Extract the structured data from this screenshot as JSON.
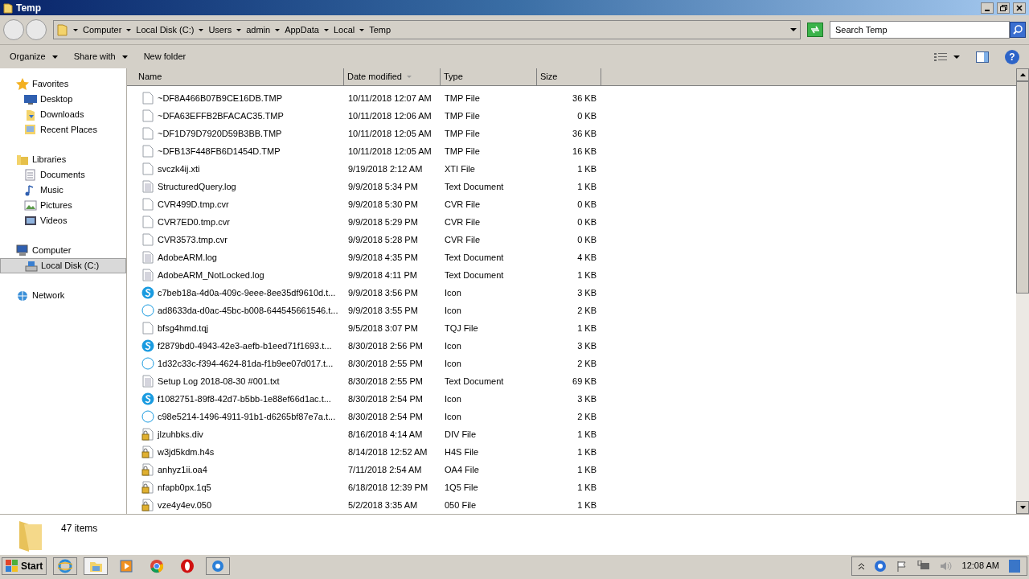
{
  "window": {
    "title": "Temp"
  },
  "breadcrumb": [
    "Computer",
    "Local Disk (C:)",
    "Users",
    "admin",
    "AppData",
    "Local",
    "Temp"
  ],
  "search": {
    "placeholder": "Search Temp"
  },
  "toolbar": [
    {
      "label": "Organize",
      "dropdown": true
    },
    {
      "label": "Share with",
      "dropdown": true
    },
    {
      "label": "New folder",
      "dropdown": false
    }
  ],
  "sidebar": {
    "items": [
      {
        "label": "Favorites",
        "kind": "star",
        "selected": false,
        "children": [
          {
            "label": "Desktop",
            "kind": "desktop",
            "selected": false
          },
          {
            "label": "Downloads",
            "kind": "folder",
            "selected": false
          },
          {
            "label": "Recent Places",
            "kind": "recent",
            "selected": false
          }
        ]
      },
      {
        "label": "Libraries",
        "kind": "library",
        "selected": false,
        "children": [
          {
            "label": "Documents",
            "kind": "doc",
            "selected": false
          },
          {
            "label": "Music",
            "kind": "music",
            "selected": false
          },
          {
            "label": "Pictures",
            "kind": "picture",
            "selected": false
          },
          {
            "label": "Videos",
            "kind": "video",
            "selected": false
          }
        ]
      },
      {
        "label": "Computer",
        "kind": "computer",
        "selected": false,
        "children": [
          {
            "label": "Local Disk (C:)",
            "kind": "disk",
            "selected": true
          }
        ]
      },
      {
        "label": "Network",
        "kind": "network",
        "selected": false
      }
    ]
  },
  "help_button": "?",
  "table": {
    "columns": [
      {
        "label": "Name",
        "sorted": false
      },
      {
        "label": "Date modified",
        "sorted": true
      },
      {
        "label": "Type",
        "sorted": false
      },
      {
        "label": "Size",
        "sorted": false
      }
    ],
    "rows": [
      {
        "kind": "blank",
        "name": "~DF8A466B07B9CE16DB.TMP",
        "date": "10/11/2018 12:07 AM",
        "type": "TMP File",
        "size": "36 KB"
      },
      {
        "kind": "blank",
        "name": "~DFA63EFFB2BFACAC35.TMP",
        "date": "10/11/2018 12:06 AM",
        "type": "TMP File",
        "size": "0 KB"
      },
      {
        "kind": "blank",
        "name": "~DF1D79D7920D59B3BB.TMP",
        "date": "10/11/2018 12:05 AM",
        "type": "TMP File",
        "size": "36 KB"
      },
      {
        "kind": "blank",
        "name": "~DFB13F448FB6D1454D.TMP",
        "date": "10/11/2018 12:05 AM",
        "type": "TMP File",
        "size": "16 KB"
      },
      {
        "kind": "blank",
        "name": "svczk4ij.xti",
        "date": "9/19/2018 2:12 AM",
        "type": "XTI File",
        "size": "1 KB"
      },
      {
        "kind": "text",
        "name": "StructuredQuery.log",
        "date": "9/9/2018 5:34 PM",
        "type": "Text Document",
        "size": "1 KB"
      },
      {
        "kind": "blank",
        "name": "CVR499D.tmp.cvr",
        "date": "9/9/2018 5:30 PM",
        "type": "CVR File",
        "size": "0 KB"
      },
      {
        "kind": "blank",
        "name": "CVR7ED0.tmp.cvr",
        "date": "9/9/2018 5:29 PM",
        "type": "CVR File",
        "size": "0 KB"
      },
      {
        "kind": "blank",
        "name": "CVR3573.tmp.cvr",
        "date": "9/9/2018 5:28 PM",
        "type": "CVR File",
        "size": "0 KB"
      },
      {
        "kind": "text",
        "name": "AdobeARM.log",
        "date": "9/9/2018 4:35 PM",
        "type": "Text Document",
        "size": "4 KB"
      },
      {
        "kind": "text",
        "name": "AdobeARM_NotLocked.log",
        "date": "9/9/2018 4:11 PM",
        "type": "Text Document",
        "size": "1 KB"
      },
      {
        "kind": "skype",
        "name": "c7beb18a-4d0a-409c-9eee-8ee35df9610d.t...",
        "date": "9/9/2018 3:56 PM",
        "type": "Icon",
        "size": "3 KB"
      },
      {
        "kind": "outline",
        "name": "ad8633da-d0ac-45bc-b008-644545661546.t...",
        "date": "9/9/2018 3:55 PM",
        "type": "Icon",
        "size": "2 KB"
      },
      {
        "kind": "blank",
        "name": "bfsg4hmd.tqj",
        "date": "9/5/2018 3:07 PM",
        "type": "TQJ File",
        "size": "1 KB"
      },
      {
        "kind": "skype",
        "name": "f2879bd0-4943-42e3-aefb-b1eed71f1693.t...",
        "date": "8/30/2018 2:56 PM",
        "type": "Icon",
        "size": "3 KB"
      },
      {
        "kind": "outline",
        "name": "1d32c33c-f394-4624-81da-f1b9ee07d017.t...",
        "date": "8/30/2018 2:55 PM",
        "type": "Icon",
        "size": "2 KB"
      },
      {
        "kind": "text",
        "name": "Setup Log 2018-08-30 #001.txt",
        "date": "8/30/2018 2:55 PM",
        "type": "Text Document",
        "size": "69 KB"
      },
      {
        "kind": "skype",
        "name": "f1082751-89f8-42d7-b5bb-1e88ef66d1ac.t...",
        "date": "8/30/2018 2:54 PM",
        "type": "Icon",
        "size": "3 KB"
      },
      {
        "kind": "outline",
        "name": "c98e5214-1496-4911-91b1-d6265bf87e7a.t...",
        "date": "8/30/2018 2:54 PM",
        "type": "Icon",
        "size": "2 KB"
      },
      {
        "kind": "locked",
        "name": "jlzuhbks.div",
        "date": "8/16/2018 4:14 AM",
        "type": "DIV File",
        "size": "1 KB"
      },
      {
        "kind": "locked",
        "name": "w3jd5kdm.h4s",
        "date": "8/14/2018 12:52 AM",
        "type": "H4S File",
        "size": "1 KB"
      },
      {
        "kind": "locked",
        "name": "anhyz1ii.oa4",
        "date": "7/11/2018 2:54 AM",
        "type": "OA4 File",
        "size": "1 KB"
      },
      {
        "kind": "locked",
        "name": "nfapb0px.1q5",
        "date": "6/18/2018 12:39 PM",
        "type": "1Q5 File",
        "size": "1 KB"
      },
      {
        "kind": "locked",
        "name": "vze4y4ev.050",
        "date": "5/2/2018 3:35 AM",
        "type": "050 File",
        "size": "1 KB"
      }
    ]
  },
  "status_bar": {
    "text": "47 items"
  },
  "taskbar": {
    "start": "Start",
    "apps": [
      {
        "kind": "ie",
        "active": false
      },
      {
        "kind": "explorer",
        "active": true
      },
      {
        "kind": "media",
        "active": false
      },
      {
        "kind": "chrome",
        "active": false
      },
      {
        "kind": "opera",
        "active": false
      },
      {
        "kind": "gear",
        "active": false
      }
    ],
    "clock": "12:08 AM"
  }
}
